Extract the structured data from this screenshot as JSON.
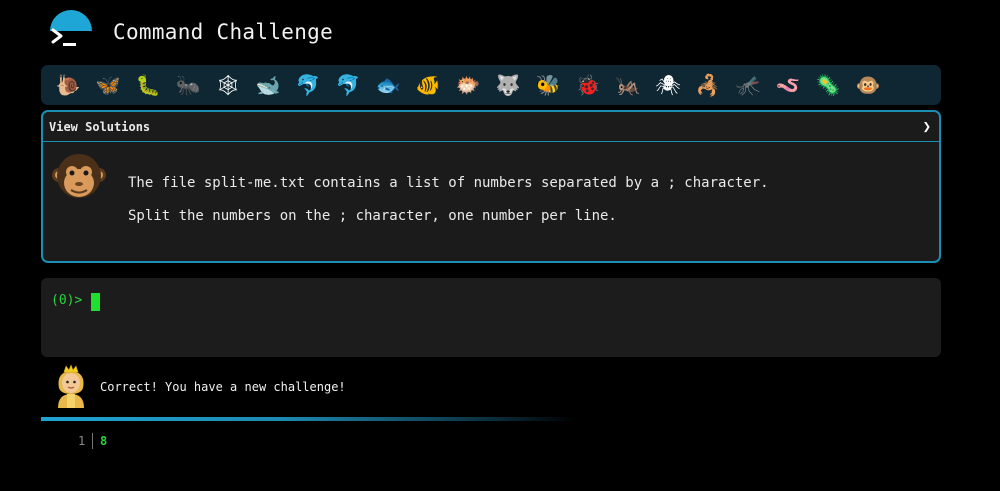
{
  "header": {
    "title": "Command Challenge",
    "logo_icon": "terminal-prompt-icon"
  },
  "animals": [
    "🐌",
    "🦋",
    "🐛",
    "🐜",
    "🕸",
    "🐋",
    "🐬",
    "🐬",
    "🐟",
    "🐠",
    "🐡",
    "🐺",
    "🐝",
    "🐞",
    "🦗",
    "🕷",
    "🦂",
    "🦟",
    "🪱",
    "🦠",
    "🐵"
  ],
  "panel": {
    "header_label": "View Solutions",
    "line1": "The file split-me.txt contains a list of numbers separated by a ; character.",
    "line2": "Split the numbers on the ; character, one number per line."
  },
  "terminal": {
    "prompt": "(0)>"
  },
  "message": {
    "text": "Correct! You have a new challenge!"
  },
  "progress_fraction": 0.53,
  "output": {
    "line_number": "1",
    "value": "8"
  },
  "colors": {
    "accent": "#1ea7d6",
    "terminal_green": "#29d43b",
    "panel_bg": "#1b1b1b"
  }
}
